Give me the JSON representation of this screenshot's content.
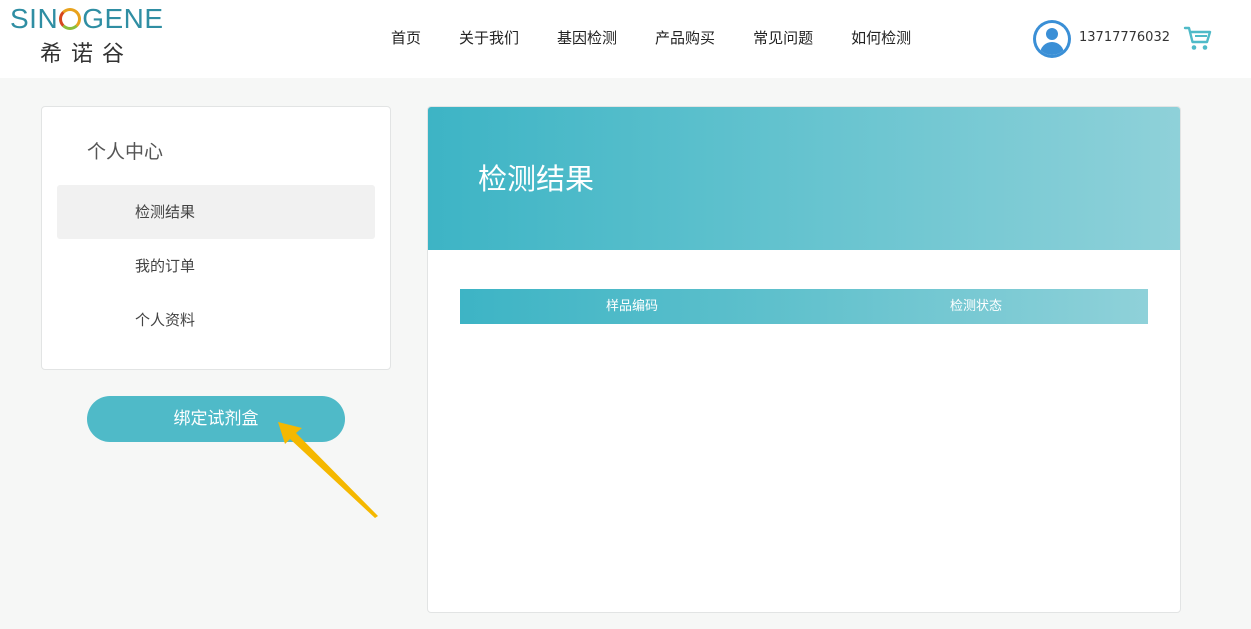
{
  "header": {
    "logo_en_left": "SIN",
    "logo_en_right": "GENE",
    "logo_cn": "希诺谷",
    "nav": [
      "首页",
      "关于我们",
      "基因检测",
      "产品购买",
      "常见问题",
      "如何检测"
    ],
    "phone": "13717776032"
  },
  "sidebar": {
    "title": "个人中心",
    "items": [
      "检测结果",
      "我的订单",
      "个人资料"
    ],
    "bind_button": "绑定试剂盒"
  },
  "main": {
    "banner_title": "检测结果",
    "table_headers": [
      "样品编码",
      "检测状态"
    ]
  },
  "colors": {
    "accent": "#4fbac8",
    "arrow": "#f5b800",
    "avatar": "#3a8fd6"
  }
}
